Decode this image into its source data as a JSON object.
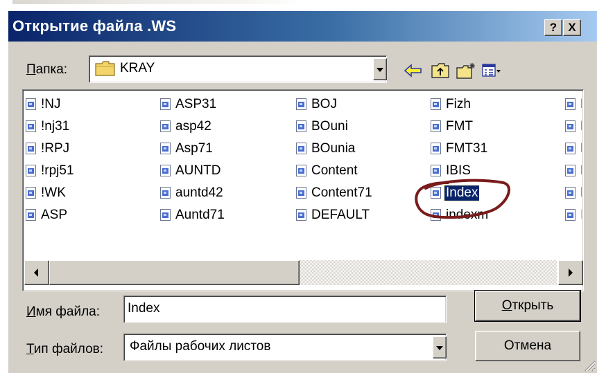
{
  "window": {
    "title": "Открытие файла .WS",
    "help_label": "?",
    "close_label": "X"
  },
  "location": {
    "label_underlined": "П",
    "label_rest": "апка:",
    "current_folder": "KRAY"
  },
  "toolbar": {
    "icons": [
      "back-arrow-icon",
      "up-folder-icon",
      "new-folder-icon",
      "view-menu-icon"
    ]
  },
  "files": {
    "columns": [
      [
        "!NJ",
        "!nj31",
        "!RPJ",
        "!rpj51",
        "!WK",
        "ASP"
      ],
      [
        "ASP31",
        "asp42",
        "Asp71",
        "AUNTD",
        "auntd42",
        "Auntd71"
      ],
      [
        "BOJ",
        "BOuni",
        "BOunia",
        "Content",
        "Content71",
        "DEFAULT"
      ],
      [
        "Fizh",
        "FMT",
        "FMT31",
        "IBIS",
        "Index",
        "indexm"
      ],
      [
        "K",
        "K",
        "K",
        "K",
        "K",
        "I"
      ]
    ],
    "selected": "Index",
    "selected_column": 3,
    "selected_row": 4,
    "scroll_fraction": 0.49
  },
  "filename": {
    "label_underlined": "И",
    "label_rest": "мя файла:",
    "value": "Index"
  },
  "filetype": {
    "label_underlined": "Т",
    "label_rest": "ип файлов:",
    "value": "Файлы рабочих листов"
  },
  "buttons": {
    "open_underlined": "О",
    "open_rest": "ткрыть",
    "cancel": "Отмена"
  },
  "colors": {
    "title_gradient_start": "#0a246a",
    "title_gradient_end": "#a6caf0",
    "face": "#d4d0c8",
    "selection": "#0a246a",
    "annotation": "#7a1c1c"
  }
}
